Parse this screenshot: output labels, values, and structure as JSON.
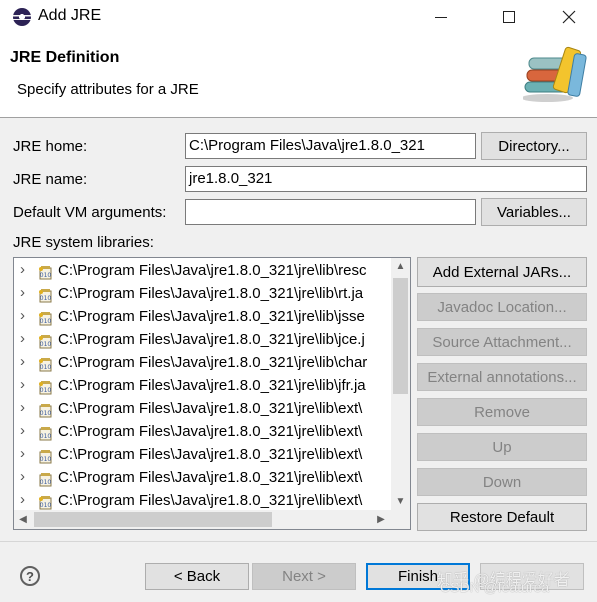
{
  "window": {
    "title": "Add JRE",
    "app_icon": "eclipse-icon"
  },
  "header": {
    "title": "JRE Definition",
    "subtitle": "Specify attributes for a JRE",
    "graphic_icon": "library-books-icon"
  },
  "form": {
    "jre_home_label": "JRE home:",
    "jre_home_value": "C:\\Program Files\\Java\\jre1.8.0_321",
    "directory_button": "Directory...",
    "jre_name_label": "JRE name:",
    "jre_name_value": "jre1.8.0_321",
    "vm_args_label": "Default VM arguments:",
    "vm_args_value": "",
    "variables_button": "Variables...",
    "libraries_label": "JRE system libraries:"
  },
  "libraries": [
    {
      "path": "C:\\Program Files\\Java\\jre1.8.0_321\\jre\\lib\\resc",
      "icon": "jar-source-icon"
    },
    {
      "path": "C:\\Program Files\\Java\\jre1.8.0_321\\jre\\lib\\rt.ja",
      "icon": "jar-source-icon"
    },
    {
      "path": "C:\\Program Files\\Java\\jre1.8.0_321\\jre\\lib\\jsse",
      "icon": "jar-source-icon"
    },
    {
      "path": "C:\\Program Files\\Java\\jre1.8.0_321\\jre\\lib\\jce.j",
      "icon": "jar-source-icon"
    },
    {
      "path": "C:\\Program Files\\Java\\jre1.8.0_321\\jre\\lib\\char",
      "icon": "jar-source-icon"
    },
    {
      "path": "C:\\Program Files\\Java\\jre1.8.0_321\\jre\\lib\\jfr.ja",
      "icon": "jar-source-icon"
    },
    {
      "path": "C:\\Program Files\\Java\\jre1.8.0_321\\jre\\lib\\ext\\",
      "icon": "jar-icon"
    },
    {
      "path": "C:\\Program Files\\Java\\jre1.8.0_321\\jre\\lib\\ext\\",
      "icon": "jar-icon"
    },
    {
      "path": "C:\\Program Files\\Java\\jre1.8.0_321\\jre\\lib\\ext\\",
      "icon": "jar-icon"
    },
    {
      "path": "C:\\Program Files\\Java\\jre1.8.0_321\\jre\\lib\\ext\\",
      "icon": "jar-icon"
    },
    {
      "path": "C:\\Program Files\\Java\\jre1.8.0_321\\jre\\lib\\ext\\",
      "icon": "jar-source-icon"
    }
  ],
  "side_buttons": {
    "add_external_jars": "Add External JARs...",
    "javadoc_location": "Javadoc Location...",
    "source_attachment": "Source Attachment...",
    "external_annotations": "External annotations...",
    "remove": "Remove",
    "up": "Up",
    "down": "Down",
    "restore_default": "Restore Default"
  },
  "footer": {
    "help": "?",
    "back": "< Back",
    "next": "Next >",
    "finish": "Finish",
    "watermark_line1": "知乎 @编程爱好者",
    "watermark_line2": "CSDN @featurea"
  }
}
